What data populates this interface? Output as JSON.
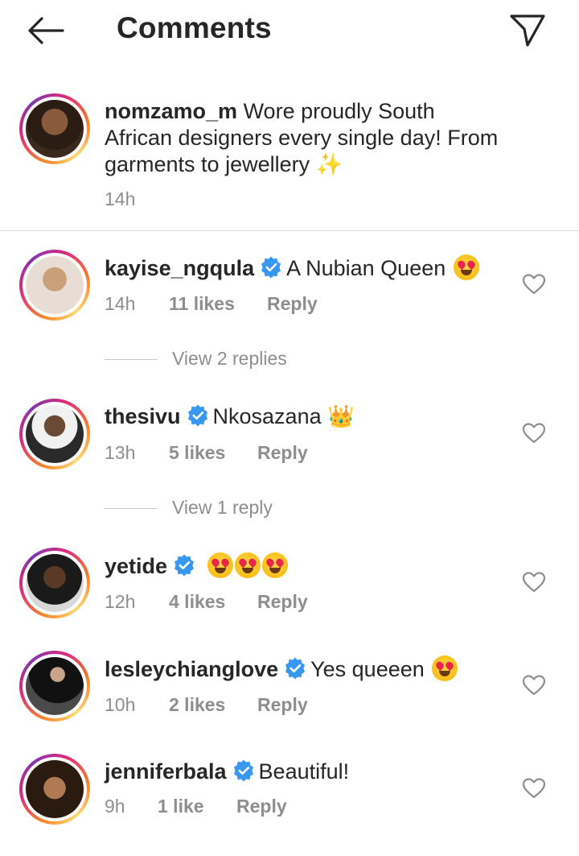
{
  "header": {
    "title": "Comments",
    "back_icon": "arrow-left-icon",
    "send_icon": "send-direct-icon"
  },
  "caption": {
    "username": "nomzamo_m",
    "line1": "Wore proudly South",
    "line2": "African designers every single day! From",
    "line3": "garments to jewellery",
    "sparkle_emoji": "✨",
    "time": "14h"
  },
  "comments": [
    {
      "username": "kayise_ngqula",
      "verified": true,
      "text": "A Nubian Queen",
      "time": "14h",
      "likes": "11 likes",
      "reply": "Reply",
      "view_replies": "View 2 replies"
    },
    {
      "username": "thesivu",
      "verified": true,
      "text": "Nkosazana",
      "emoji": "👑",
      "time": "13h",
      "likes": "5 likes",
      "reply": "Reply",
      "view_replies": "View 1 reply"
    },
    {
      "username": "yetide",
      "verified": true,
      "text": "",
      "time": "12h",
      "likes": "4 likes",
      "reply": "Reply"
    },
    {
      "username": "lesleychianglove",
      "verified": true,
      "text": "Yes queeen",
      "time": "10h",
      "likes": "2 likes",
      "reply": "Reply"
    },
    {
      "username": "jenniferbala",
      "verified": true,
      "text": "Beautiful!",
      "time": "9h",
      "likes": "1 like",
      "reply": "Reply"
    }
  ],
  "colors": {
    "text": "#262626",
    "secondary": "#8e8e8e",
    "verified": "#3897f0",
    "ring_start": "#f58529",
    "ring_end": "#dd2a7b"
  }
}
